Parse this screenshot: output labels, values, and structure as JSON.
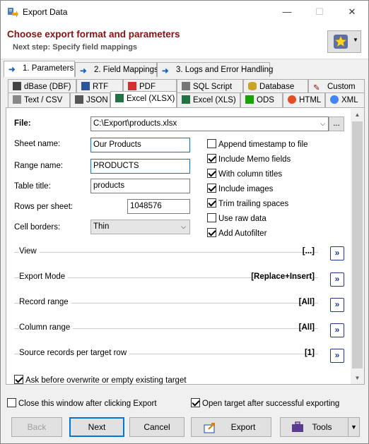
{
  "window": {
    "title": "Export Data",
    "minimize": "—",
    "maximize": "☐",
    "close": "✕"
  },
  "header": {
    "title": "Choose export format and parameters",
    "subtitle": "Next step: Specify field mappings"
  },
  "step_tabs": [
    "1. Parameters",
    "2. Field Mappings",
    "3. Logs and Error Handling"
  ],
  "format_tabs_row1": [
    "dBase (DBF)",
    "RTF",
    "PDF",
    "SQL Script",
    "Database",
    "Custom"
  ],
  "format_tabs_row2": [
    "Text / CSV",
    "JSON",
    "Excel (XLSX)",
    "Excel (XLS)",
    "ODS",
    "HTML",
    "XML"
  ],
  "form": {
    "file_label": "File:",
    "file_value": "C:\\Export\\products.xlsx",
    "browse_label": "...",
    "sheet_label": "Sheet name:",
    "sheet_value": "Our Products",
    "range_label": "Range name:",
    "range_value": "PRODUCTS",
    "table_label": "Table title:",
    "table_value": "products",
    "rows_label": "Rows per sheet:",
    "rows_value": "1048576",
    "borders_label": "Cell borders:",
    "borders_value": "Thin"
  },
  "options": [
    {
      "label": "Append timestamp to file",
      "checked": false
    },
    {
      "label": "Include Memo fields",
      "checked": true
    },
    {
      "label": "With column titles",
      "checked": true
    },
    {
      "label": "Include images",
      "checked": true
    },
    {
      "label": "Trim trailing spaces",
      "checked": true
    },
    {
      "label": "Use raw data",
      "checked": false
    },
    {
      "label": "Add Autofilter",
      "checked": true
    }
  ],
  "sections": [
    {
      "label": "View",
      "value": "[...]"
    },
    {
      "label": "Export Mode",
      "value": "[Replace+Insert]"
    },
    {
      "label": "Record range",
      "value": "[All]"
    },
    {
      "label": "Column range",
      "value": "[All]"
    },
    {
      "label": "Source records per target row",
      "value": "[1]"
    }
  ],
  "ask_overwrite": {
    "label": "Ask before overwrite or empty existing target",
    "checked": true
  },
  "footer": {
    "close_after": {
      "label": "Close this window after clicking Export",
      "checked": false
    },
    "open_target": {
      "label": "Open target after successful exporting",
      "checked": true
    }
  },
  "buttons": {
    "back": "Back",
    "next": "Next",
    "cancel": "Cancel",
    "export": "Export",
    "tools": "Tools"
  },
  "colors": {
    "header_title": "#8b1010",
    "accent": "#0078d7",
    "arrow_button": "#1d3a8f"
  }
}
